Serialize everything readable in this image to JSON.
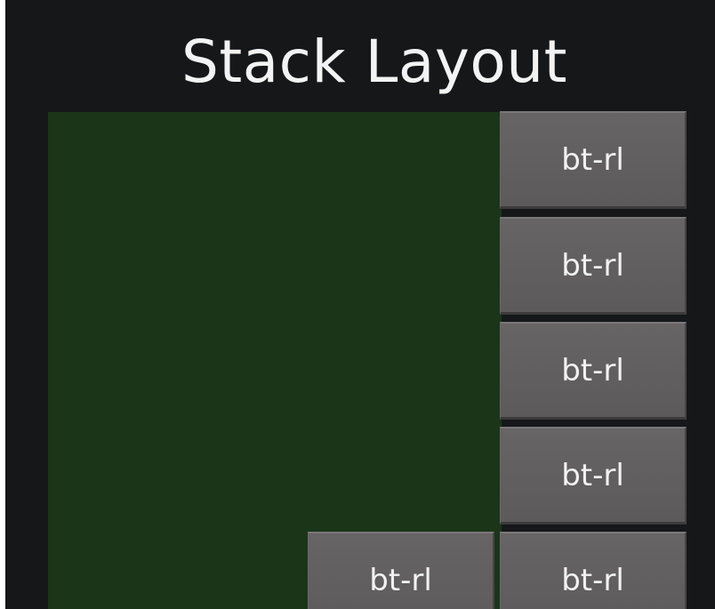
{
  "title": "Stack Layout",
  "buttons": [
    {
      "label": "bt-rl"
    },
    {
      "label": "bt-rl"
    },
    {
      "label": "bt-rl"
    },
    {
      "label": "bt-rl"
    },
    {
      "label": "bt-rl"
    },
    {
      "label": "bt-rl"
    }
  ],
  "colors": {
    "background": "#151719",
    "stack_area": "#1b3519",
    "button": "#5f5d5d",
    "text": "#f2f2f2"
  }
}
